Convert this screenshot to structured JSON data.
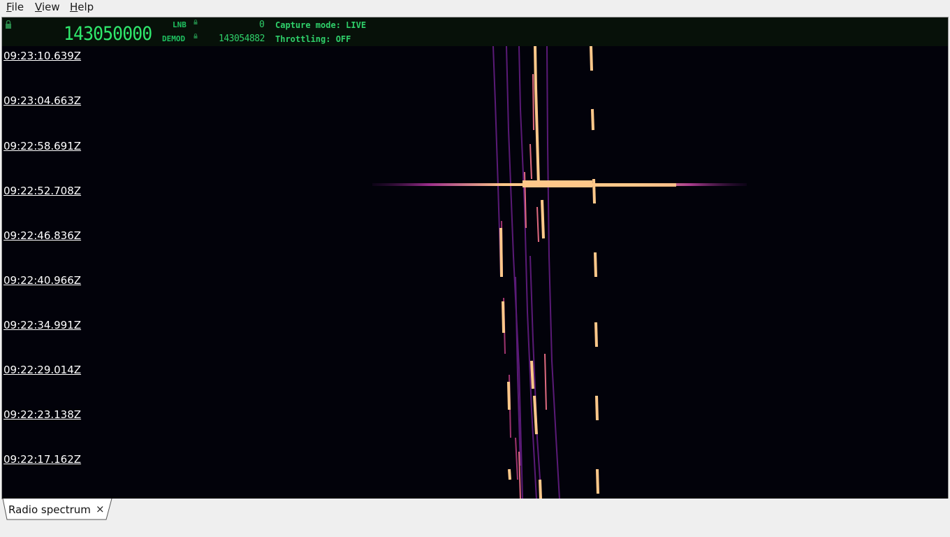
{
  "menu": {
    "file": "File",
    "view": "View",
    "help": "Help"
  },
  "status": {
    "frequency": "143050000",
    "lnb_label": "LNB",
    "lnb_value": "0",
    "demod_label": "DEMOD",
    "demod_value": "143054882",
    "capture_mode": "Capture mode: LIVE",
    "throttling": "Throttling: OFF"
  },
  "timestamps": [
    "09:23:10.639Z",
    "09:23:04.663Z",
    "09:22:58.691Z",
    "09:22:52.708Z",
    "09:22:46.836Z",
    "09:22:40.966Z",
    "09:22:34.991Z",
    "09:22:29.014Z",
    "09:22:23.138Z",
    "09:22:17.162Z"
  ],
  "tabs": [
    {
      "label": "Radio spectrum",
      "close": "×"
    }
  ],
  "colors": {
    "background": "#02020a",
    "status_text": "#2fd06a",
    "signal_hot": "#ffc88a",
    "signal_mid": "#8a2aa0"
  }
}
